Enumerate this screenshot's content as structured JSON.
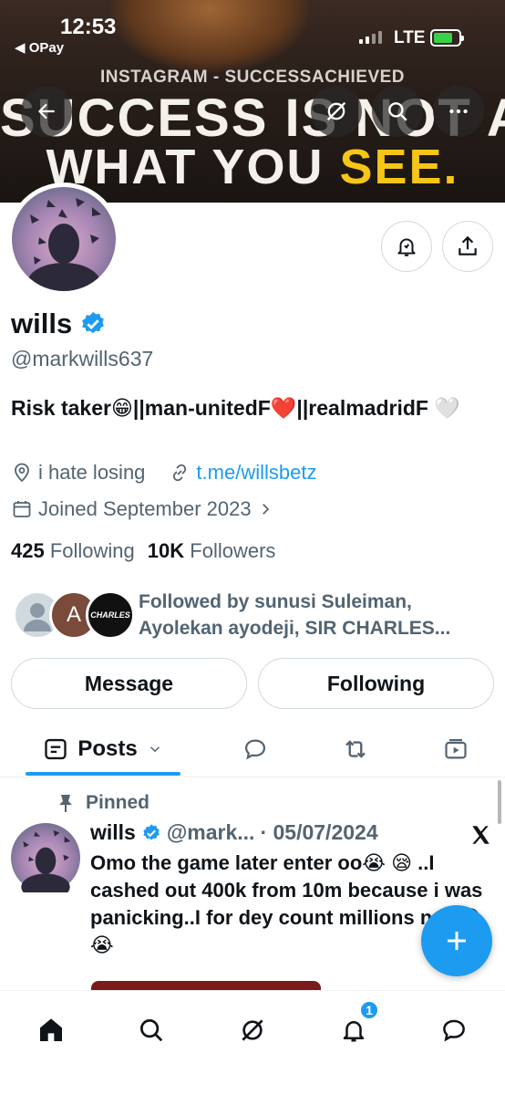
{
  "status_bar": {
    "time": "12:53",
    "back_app": "◀ OPay",
    "network": "LTE"
  },
  "banner": {
    "watermark": "INSTAGRAM - SUCCESSACHIEVED",
    "line1": "SUCCESS IS NOT ALWAY",
    "line2_a": "WHAT YOU ",
    "line2_b": "SEE."
  },
  "profile": {
    "name": "wills",
    "handle": "@markwills637",
    "bio": "Risk taker😁||man-unitedF❤️||realmadridF 🤍",
    "location": "i hate losing",
    "website": "t.me/willsbetz",
    "joined": "Joined September 2023",
    "following_count": "425",
    "following_label": "Following",
    "followers_count": "10K",
    "followers_label": "Followers",
    "followed_by_line1": "Followed by sunusi Suleiman,",
    "followed_by_line2": "Ayolekan ayodeji, SIR CHARLES...",
    "avatar_letter": "A",
    "avatar_label_3": "CHARLES"
  },
  "actions": {
    "message": "Message",
    "following": "Following"
  },
  "tabs": {
    "posts": "Posts"
  },
  "pinned_post": {
    "pinned_label": "Pinned",
    "author": "wills",
    "handle": "@mark...",
    "date": "· 05/07/2024",
    "text": "Omo the game later enter oo😭 😪 ..I cashed out 400k from 10m because i was panicking..I for dey count millions now😪 😭"
  },
  "nav": {
    "notifications_badge": "1"
  },
  "colors": {
    "accent": "#1d9bf0",
    "text": "#0f1419",
    "secondary": "#536471",
    "border": "#cfd9de"
  }
}
